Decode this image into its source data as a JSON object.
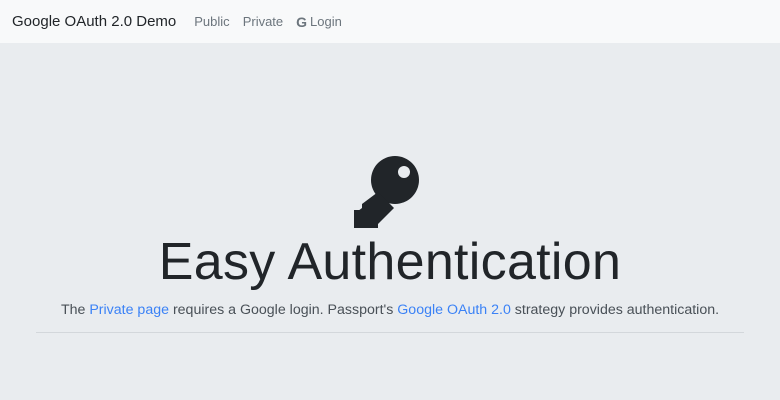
{
  "navbar": {
    "brand": "Google OAuth 2.0 Demo",
    "links": [
      {
        "label": "Public"
      },
      {
        "label": "Private"
      },
      {
        "label": "Login",
        "icon": "google-icon",
        "icon_glyph": "G"
      }
    ]
  },
  "hero": {
    "icon": "key-icon",
    "title": "Easy Authentication",
    "lead_parts": {
      "p1": "The ",
      "link1": "Private page",
      "p2": " requires a Google login. Passport's ",
      "link2": "Google OAuth 2.0",
      "p3": " strategy provides authentication."
    }
  },
  "colors": {
    "navbar_bg": "#f8f9fa",
    "page_bg": "#e9ecef",
    "link": "#3b82f6",
    "text_dark": "#212529"
  }
}
